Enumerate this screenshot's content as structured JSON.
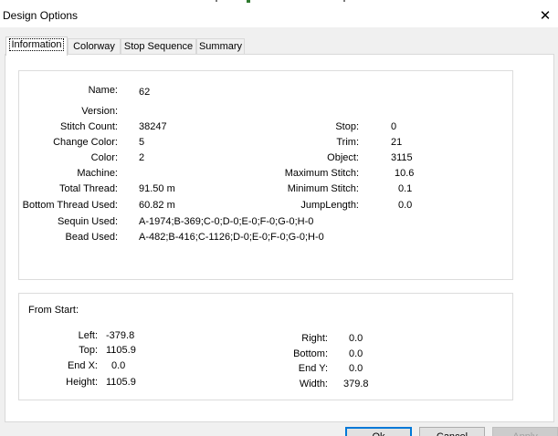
{
  "window": {
    "title": "Design Options",
    "close_glyph": "✕"
  },
  "tabs": [
    {
      "label": "Information"
    },
    {
      "label": "Colorway"
    },
    {
      "label": "Stop Sequence"
    },
    {
      "label": "Summary"
    }
  ],
  "info": {
    "name": {
      "label": "Name:",
      "value": "62"
    },
    "version": {
      "label": "Version:",
      "value": ""
    },
    "stitch_count": {
      "label": "Stitch Count:",
      "value": "38247"
    },
    "change_color": {
      "label": "Change Color:",
      "value": "5"
    },
    "color": {
      "label": "Color:",
      "value": "2"
    },
    "machine": {
      "label": "Machine:",
      "value": ""
    },
    "total_thread": {
      "label": "Total Thread:",
      "value": "91.50 m"
    },
    "bottom_thread_used": {
      "label": "Bottom Thread Used:",
      "value": "60.82 m"
    },
    "sequin_used": {
      "label": "Sequin Used:",
      "value": "A-1974;B-369;C-0;D-0;E-0;F-0;G-0;H-0"
    },
    "bead_used": {
      "label": "Bead Used:",
      "value": "A-482;B-416;C-1126;D-0;E-0;F-0;G-0;H-0"
    },
    "stop": {
      "label": "Stop:",
      "value": "0"
    },
    "trim": {
      "label": "Trim:",
      "value": "21"
    },
    "object": {
      "label": "Object:",
      "value": "3115"
    },
    "maximum_stitch": {
      "label": "Maximum Stitch:",
      "value": "10.6"
    },
    "minimum_stitch": {
      "label": "Minimum Stitch:",
      "value": "0.1"
    },
    "jump_length": {
      "label": "JumpLength:",
      "value": "0.0"
    }
  },
  "from_start": {
    "title": "From Start:",
    "left": {
      "label": "Left:",
      "value": "-379.8"
    },
    "top": {
      "label": "Top:",
      "value": "1105.9"
    },
    "end_x": {
      "label": "End X:",
      "value": "0.0"
    },
    "height": {
      "label": "Height:",
      "value": "1105.9"
    },
    "right": {
      "label": "Right:",
      "value": "0.0"
    },
    "bottom": {
      "label": "Bottom:",
      "value": "0.0"
    },
    "end_y": {
      "label": "End Y:",
      "value": "0.0"
    },
    "width": {
      "label": "Width:",
      "value": "379.8"
    }
  },
  "buttons": {
    "ok": "Ok",
    "cancel": "Cancel",
    "apply": "Apply"
  },
  "colors": {
    "accent": "#0078d7",
    "dialog_bg": "#f0f0f0"
  }
}
